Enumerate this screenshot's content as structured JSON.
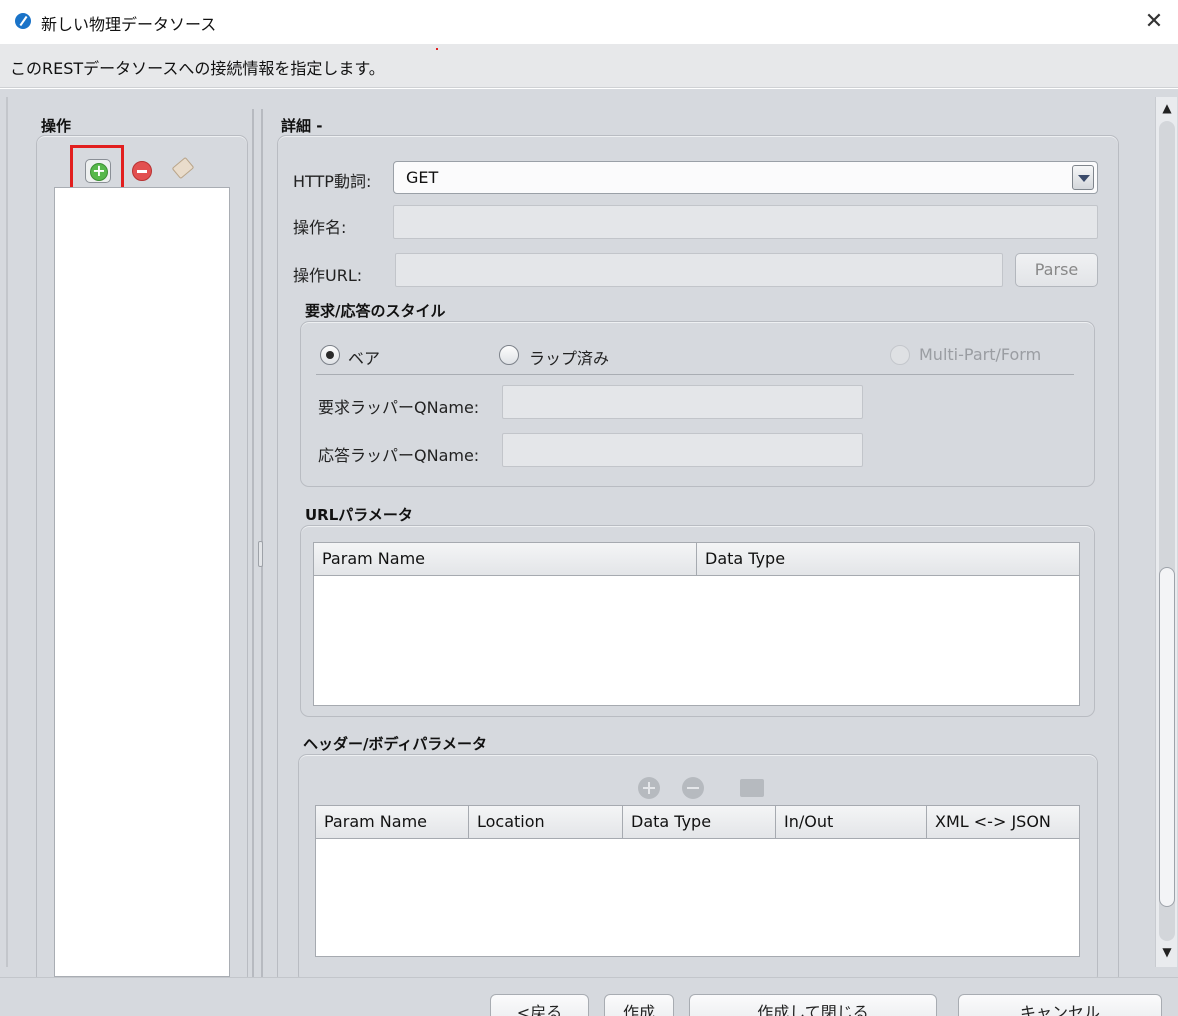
{
  "window": {
    "title": "新しい物理データソース",
    "close_icon": "close-icon"
  },
  "description": "このRESTデータソースへの接続情報を指定します。",
  "operations": {
    "title": "操作",
    "toolbar": {
      "add_icon": "add-icon",
      "remove_icon": "remove-icon",
      "tag_icon": "tag-icon"
    },
    "items": []
  },
  "details": {
    "title": "詳細 -",
    "http_verb_label": "HTTP動詞:",
    "http_verb_value": "GET",
    "operation_name_label": "操作名:",
    "operation_name_value": "",
    "operation_url_label": "操作URL:",
    "operation_url_value": "",
    "parse_button": "Parse",
    "style_section": {
      "title": "要求/応答のスタイル",
      "options": [
        {
          "label": "ベア",
          "selected": true,
          "enabled": true
        },
        {
          "label": "ラップ済み",
          "selected": false,
          "enabled": true
        },
        {
          "label": "Multi-Part/Form",
          "selected": false,
          "enabled": false
        }
      ],
      "request_wrapper_label": "要求ラッパーQName:",
      "request_wrapper_value": "",
      "response_wrapper_label": "応答ラッパーQName:",
      "response_wrapper_value": ""
    },
    "url_params": {
      "title": "URLパラメータ",
      "columns": [
        "Param Name",
        "Data Type"
      ],
      "rows": []
    },
    "header_body_params": {
      "title": "ヘッダー/ボディパラメータ",
      "columns": [
        "Param Name",
        "Location",
        "Data Type",
        "In/Out",
        "XML <-> JSON"
      ],
      "rows": []
    }
  },
  "footer": {
    "back_button": "<戻る",
    "create_button": "作成",
    "create_close_button": "作成して閉じる",
    "cancel_button": "キャンセル"
  },
  "colors": {
    "highlight_frame": "#e21f1f",
    "panel_bg": "#d6d9de"
  }
}
